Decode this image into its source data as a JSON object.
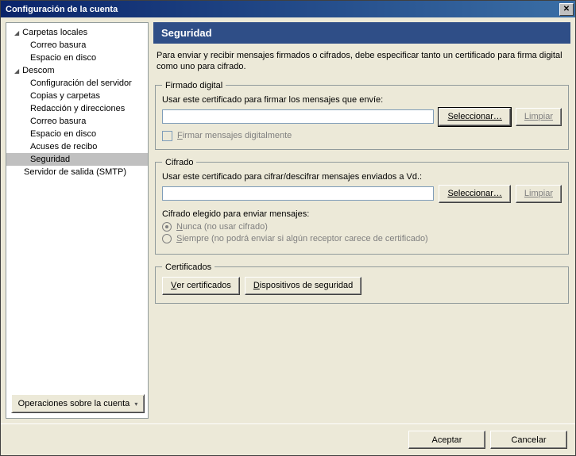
{
  "window": {
    "title": "Configuración de la cuenta"
  },
  "sidebar": {
    "items": [
      {
        "label": "Carpetas locales",
        "root": true
      },
      {
        "label": "Correo basura"
      },
      {
        "label": "Espacio en disco"
      },
      {
        "label": "Descom",
        "root": true
      },
      {
        "label": "Configuración del servidor"
      },
      {
        "label": "Copias y carpetas"
      },
      {
        "label": "Redacción y direcciones"
      },
      {
        "label": "Correo basura"
      },
      {
        "label": "Espacio en disco"
      },
      {
        "label": "Acuses de recibo"
      },
      {
        "label": "Seguridad",
        "selected": true
      },
      {
        "label": "Servidor de salida (SMTP)",
        "root": true,
        "noarrow": true
      }
    ],
    "ops_button": "Operaciones sobre la cuenta"
  },
  "main": {
    "header": "Seguridad",
    "description": "Para enviar y recibir mensajes firmados o cifrados, debe especificar tanto un certificado para firma digital como uno para cifrado.",
    "signing": {
      "legend": "Firmado digital",
      "label": "Usar este certificado para firmar los mensajes que envíe:",
      "value": "",
      "select_btn": "Seleccionar…",
      "clear_btn": "Limpiar",
      "checkbox": "Firmar mensajes digitalmente"
    },
    "encryption": {
      "legend": "Cifrado",
      "label": "Usar este certificado para cifrar/descifrar mensajes enviados a Vd.:",
      "value": "",
      "select_btn": "Seleccionar…",
      "clear_btn": "Limpiar",
      "pref_label": "Cifrado elegido para enviar mensajes:",
      "opt_never": "Nunca (no usar cifrado)",
      "opt_always": "Siempre (no podrá enviar si algún receptor carece de certificado)"
    },
    "certs": {
      "legend": "Certificados",
      "view_btn": "Ver certificados",
      "devices_btn": "Dispositivos de seguridad"
    }
  },
  "footer": {
    "ok": "Aceptar",
    "cancel": "Cancelar"
  }
}
